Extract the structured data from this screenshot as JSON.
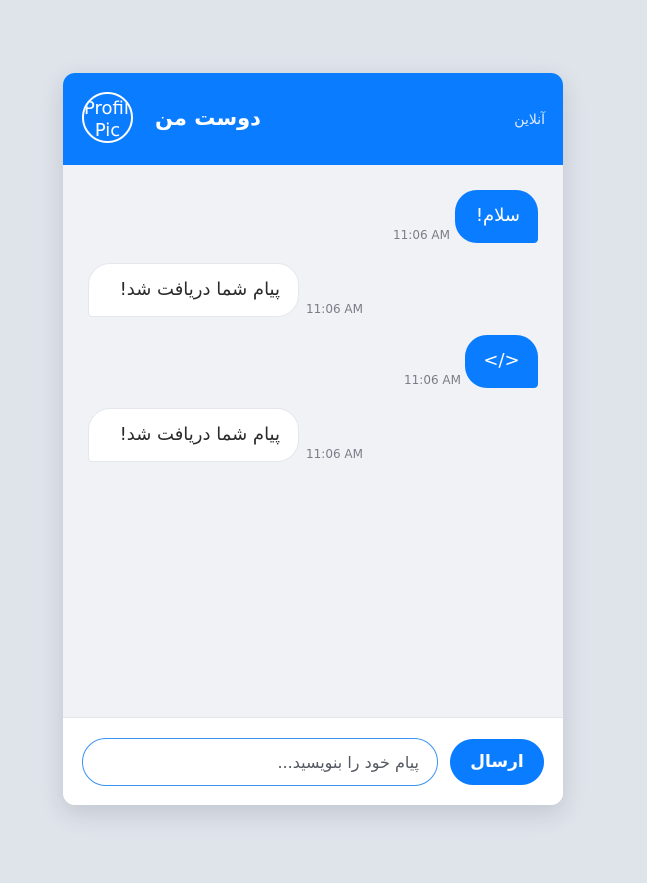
{
  "header": {
    "avatar_alt": "Profile Pic",
    "contact_name": "دوست من",
    "status": "آنلاین"
  },
  "messages": [
    {
      "type": "sent",
      "text": "سلام!",
      "time": "11:06 AM"
    },
    {
      "type": "received",
      "text": "پیام شما دریافت شد!",
      "time": "11:06 AM"
    },
    {
      "type": "sent",
      "text": "</>",
      "time": "11:06 AM"
    },
    {
      "type": "received",
      "text": "پیام شما دریافت شد!",
      "time": "11:06 AM"
    }
  ],
  "composer": {
    "placeholder": "پیام خود را بنویسید...",
    "value": "",
    "send_label": "ارسال"
  },
  "colors": {
    "accent": "#0a7cff",
    "background": "#dfe3ea",
    "chat_area": "#f0f2f6"
  }
}
